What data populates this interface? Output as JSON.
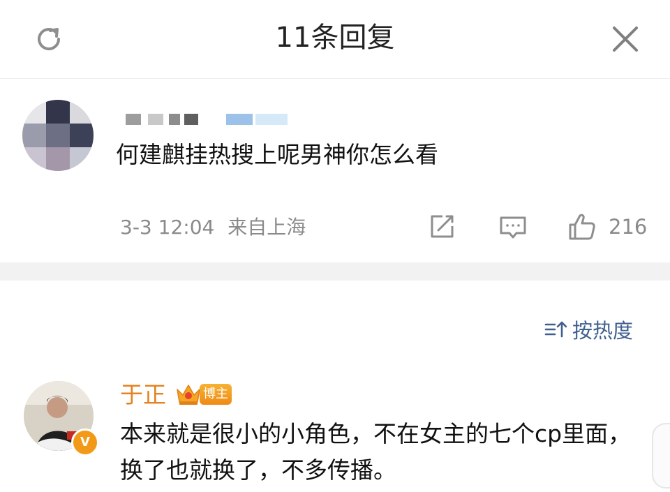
{
  "header": {
    "title": "11条回复",
    "refresh_icon": "refresh-icon",
    "close_icon": "close-icon"
  },
  "original_comment": {
    "text": "何建麒挂热搜上呢男神你怎么看",
    "timestamp": "3-3 12:04",
    "location": "来自上海",
    "like_count": "216",
    "icons": [
      "share-icon",
      "comment-icon",
      "like-icon"
    ]
  },
  "sort": {
    "label": "按热度",
    "icon": "sort-icon"
  },
  "reply": {
    "author": "于正",
    "badge": "博主",
    "text": "本来就是很小的小角色，不在女主的七个cp里面，换了也就换了，不多传播。",
    "verified_icon": "V"
  },
  "colors": {
    "author": "#e5821f",
    "sort": "#3f5f8e",
    "meta": "#8a8a8a",
    "badge": "#ef8a16"
  }
}
